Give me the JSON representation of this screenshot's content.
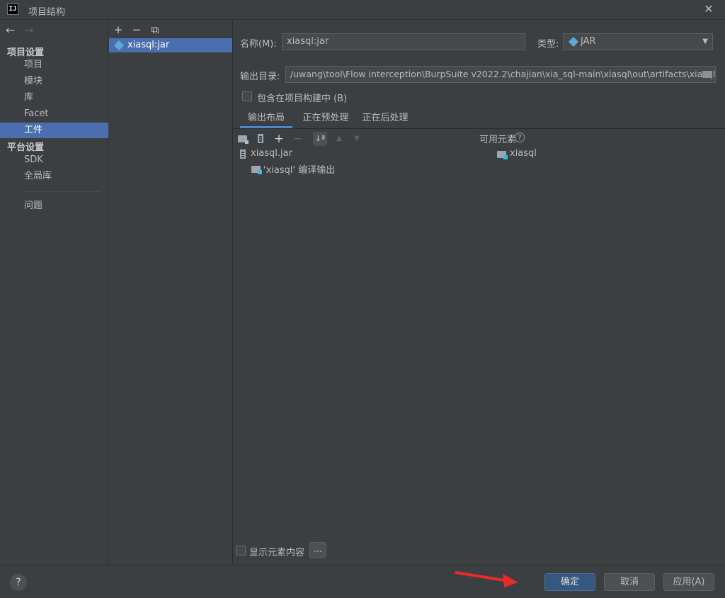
{
  "window": {
    "title": "项目结构",
    "logo_text": "IJ",
    "close_glyph": "✕"
  },
  "sidebar": {
    "back_glyph": "←",
    "forward_glyph": "→",
    "project_settings_header": "项目设置",
    "project_items": [
      "项目",
      "模块",
      "库",
      "Facet",
      "工件"
    ],
    "selected_index": 4,
    "platform_settings_header": "平台设置",
    "platform_items": [
      "SDK",
      "全局库"
    ],
    "problems_label": "问题"
  },
  "artifacts": {
    "add_glyph": "+",
    "remove_glyph": "−",
    "copy_glyph": "⧉",
    "items": [
      "xiasql:jar"
    ]
  },
  "form": {
    "name_label": "名称(M):",
    "name_value": "xiasql:jar",
    "type_label": "类型:",
    "type_value": "JAR",
    "output_dir_label": "输出目录:",
    "output_dir_value": "/uwang\\tool\\Flow interception\\BurpSuite v2022.2\\chajian\\xia_sql-main\\xiasql\\out\\artifacts\\xiasql_jar",
    "include_in_build_label": "包含在项目构建中 (B)",
    "include_in_build_checked": false
  },
  "tabs": [
    "输出布局",
    "正在预处理",
    "正在后处理"
  ],
  "active_tab": 0,
  "layout": {
    "toolbar_add_glyph": "+",
    "toolbar_remove_glyph": "−",
    "toolbar_sort_glyph": "↓ª",
    "toolbar_up_glyph": "▲",
    "toolbar_down_glyph": "▼",
    "tree_root": "xiasql.jar",
    "tree_child": "'xiasql' 编译输出",
    "available_label": "可用元素",
    "available_help_glyph": "?",
    "available_items": [
      "xiasql"
    ],
    "show_content_label": "显示元素内容",
    "more_button": "..."
  },
  "footer": {
    "help_glyph": "?",
    "ok_label": "确定",
    "cancel_label": "取消",
    "apply_label": "应用(A)"
  },
  "colors": {
    "selection": "#4b6eaf",
    "primary_button": "#365880",
    "annotation_arrow": "#e62b2b",
    "folder_icon": "#9aa7b0",
    "module_dot": "#40b6e0"
  }
}
